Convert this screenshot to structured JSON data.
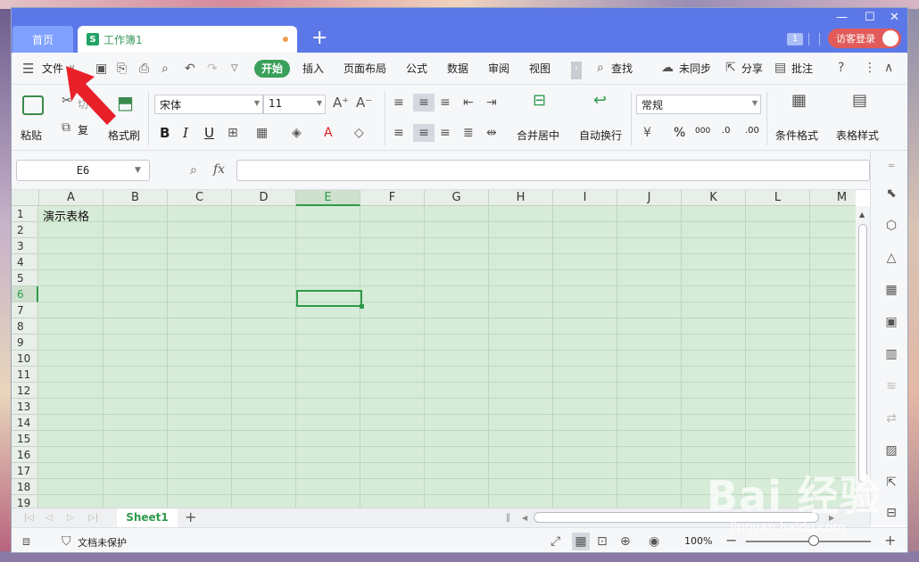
{
  "titlebar": {
    "home_tab": "首页",
    "doc_tab": "工作簿1",
    "doc_icon_letter": "S",
    "badge": "1",
    "login": "访客登录"
  },
  "menubar": {
    "file": "文件",
    "start": "开始",
    "items": [
      "插入",
      "页面布局",
      "公式",
      "数据",
      "审阅",
      "视图"
    ],
    "search": "查找",
    "sync": "未同步",
    "share": "分享",
    "comment": "批注"
  },
  "ribbon": {
    "paste": "粘贴",
    "copy": "复",
    "cut": "切",
    "format_painter": "格式刷",
    "font_name": "宋体",
    "font_size": "11",
    "merge": "合并居中",
    "wrap": "自动换行",
    "number_format": "常规",
    "cond_format": "条件格式",
    "table_style": "表格样式",
    "bold": "B",
    "italic": "I",
    "underline": "U",
    "percent": "%",
    "thousands": "000",
    "inc_dec": ".0",
    "dec_dec": ".00",
    "grow_font": "A⁺",
    "shrink_font": "A⁻",
    "font_color": "A"
  },
  "formula": {
    "name_box": "E6",
    "fx": "fx",
    "value": ""
  },
  "sheet": {
    "columns": [
      "A",
      "B",
      "C",
      "D",
      "E",
      "F",
      "G",
      "H",
      "I",
      "J",
      "K",
      "L",
      "M"
    ],
    "rows": [
      "1",
      "2",
      "3",
      "4",
      "5",
      "6",
      "7",
      "8",
      "9",
      "10",
      "11",
      "12",
      "13",
      "14",
      "15",
      "16",
      "17",
      "18",
      "19"
    ],
    "a1": "演示表格",
    "active_cell": "E6",
    "tab": "Sheet1"
  },
  "status": {
    "protect": "文档未保护",
    "zoom": "100%"
  },
  "watermark": {
    "brand": "Bai 经验",
    "url": "jingyan.baidu.com"
  },
  "colors": {
    "titlebar": "#5c78e8",
    "accent_green": "#2e9b4a",
    "grid_bg": "#d7ecd8",
    "login": "#e25b5b",
    "arrow": "#e8202a"
  }
}
